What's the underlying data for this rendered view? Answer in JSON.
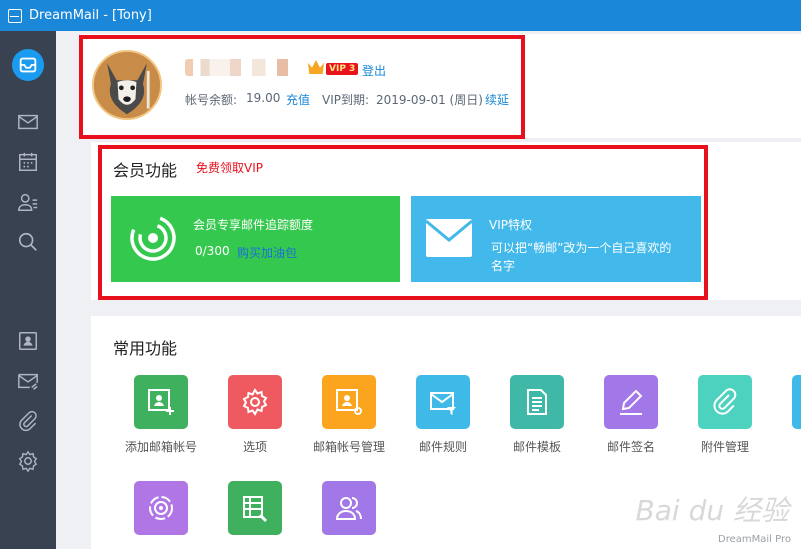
{
  "window": {
    "title": "DreamMail - [Tony]"
  },
  "sidebar": {
    "items": [
      {
        "icon": "mail-app-icon",
        "active": true
      },
      {
        "icon": "inbox-icon"
      },
      {
        "icon": "calendar-icon"
      },
      {
        "icon": "contacts-icon"
      },
      {
        "icon": "search-icon"
      },
      {
        "icon": "account-card-icon"
      },
      {
        "icon": "compose-icon"
      },
      {
        "icon": "attachment-icon"
      },
      {
        "icon": "settings-icon"
      }
    ]
  },
  "account": {
    "vip_level": "VIP 3",
    "logout": "登出",
    "balance_label": "帐号余额:",
    "balance_value": "19.00",
    "recharge": "充值",
    "vip_expiry_label": "VIP到期:",
    "vip_expiry_value": "2019-09-01 (周日)",
    "renew": "续延"
  },
  "member": {
    "title": "会员功能",
    "free_vip_link": "免费领取VIP",
    "tracking_card": {
      "title": "会员专享邮件追踪额度",
      "quota": "0/300",
      "buy_link": "购买加油包",
      "color": "#35c84e"
    },
    "vip_card": {
      "title": "VIP特权",
      "desc_line1": "可以把“畅邮”改为一个自己喜欢的",
      "desc_line2": "名字",
      "color": "#42b9ea"
    }
  },
  "common": {
    "title": "常用功能",
    "tiles": [
      {
        "label": "添加邮箱帐号",
        "icon": "add-account-icon",
        "color": "#3fb05d"
      },
      {
        "label": "选项",
        "icon": "gear-icon",
        "color": "#ef5a61"
      },
      {
        "label": "邮箱帐号管理",
        "icon": "account-manage-icon",
        "color": "#fba51f"
      },
      {
        "label": "邮件规则",
        "icon": "mail-filter-icon",
        "color": "#3fbae8"
      },
      {
        "label": "邮件模板",
        "icon": "template-icon",
        "color": "#3fb8a8"
      },
      {
        "label": "邮件签名",
        "icon": "signature-icon",
        "color": "#a277e8"
      },
      {
        "label": "附件管理",
        "icon": "paperclip-icon",
        "color": "#4dd2bf"
      },
      {
        "label": "",
        "icon": "partial-tile-icon",
        "color": "#3fbae8"
      },
      {
        "label": "",
        "icon": "target-icon",
        "color": "#b076e6"
      },
      {
        "label": "",
        "icon": "data-tools-icon",
        "color": "#3fb05d"
      },
      {
        "label": "",
        "icon": "contacts-group-icon",
        "color": "#a277e8"
      }
    ]
  },
  "watermark": {
    "text": "Bai du 经验",
    "sub": "DreamMail Pro"
  }
}
